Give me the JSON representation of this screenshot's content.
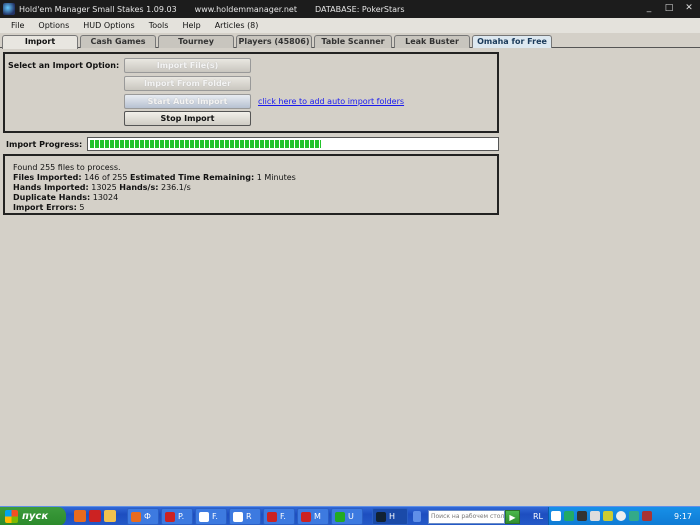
{
  "window": {
    "title": "Hold'em Manager Small Stakes 1.09.03",
    "url": "www.holdemmanager.net",
    "database": "DATABASE: PokerStars",
    "minimize": "_",
    "maximize": "□",
    "close": "✕"
  },
  "menu": [
    "File",
    "Options",
    "HUD Options",
    "Tools",
    "Help",
    "Articles (8)"
  ],
  "tabs": [
    "Import",
    "Cash Games",
    "Tourney",
    "Players (45806)",
    "Table Scanner",
    "Leak Buster",
    "Omaha for Free"
  ],
  "import_panel": {
    "label": "Select an Import Option:",
    "import_files": "Import File(s)",
    "import_folder": "Import From Folder",
    "start_auto": "Start Auto Import",
    "stop_import": "Stop Import",
    "link": "click here to add auto import folders"
  },
  "progress": {
    "label": "Import Progress:",
    "fraction": 0.57
  },
  "log": {
    "found": "Found 255 files to process.",
    "files_imported_label": "Files Imported:",
    "files_imported_value": "146 of 255",
    "est_label": "Estimated Time Remaining:",
    "est_value": "1 Minutes",
    "hands_label": "Hands Imported:",
    "hands_value": "13025",
    "hps_label": "Hands/s:",
    "hps_value": "236.1/s",
    "dup_label": "Duplicate Hands:",
    "dup_value": "13024",
    "errors_label": "Import Errors:",
    "errors_value": "5"
  },
  "taskbar": {
    "start": "пуск",
    "tasks": [
      "P.",
      "F.",
      "R",
      "F.",
      "M",
      "U",
      "H"
    ],
    "search_placeholder": "Поиск на рабочем столе",
    "go": "▶",
    "lang": "RL",
    "clock": "9:17"
  },
  "colors": {
    "progress_green": "#22c32a",
    "link_blue": "#1a1aee",
    "taskbar_blue": "#2459c7",
    "start_green": "#2b8a2b"
  }
}
